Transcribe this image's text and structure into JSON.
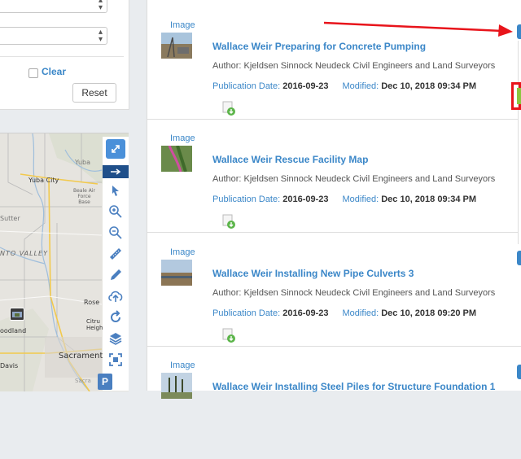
{
  "filters": {
    "clear_label": "Clear",
    "reset_label": "Reset"
  },
  "map": {
    "labels": {
      "yuba_city": "Yuba City",
      "beale": "Beale Air\nForce\nBase",
      "yuba": "Yuba",
      "sutter": "Sutter",
      "valley": "NTO VALLEY",
      "rose": "Rose",
      "citrus": "Citru\nHeigh",
      "woodland": "oodland",
      "sacramento": "Sacramento",
      "davis": "Davis",
      "sacra": "Sacra"
    },
    "tools": [
      {
        "name": "expand-icon"
      },
      {
        "name": "arrow-right-icon"
      },
      {
        "name": "pointer-icon"
      },
      {
        "name": "zoom-in-icon"
      },
      {
        "name": "zoom-out-icon"
      },
      {
        "name": "ruler-icon"
      },
      {
        "name": "pencil-icon"
      },
      {
        "name": "cloud-upload-icon"
      },
      {
        "name": "refresh-icon"
      },
      {
        "name": "layers-icon"
      },
      {
        "name": "fullscreen-icon"
      },
      {
        "name": "parking-icon",
        "label": "P"
      }
    ]
  },
  "results": [
    {
      "type": "Image",
      "title": "Wallace Weir Preparing for Concrete Pumping",
      "author": "Author: Kjeldsen Sinnock Neudeck Civil Engineers and Land Surveyors",
      "pub_label": "Publication Date:",
      "pub_value": "2016-09-23",
      "mod_label": "Modified:",
      "mod_value": "Dec 10, 2018 09:34 PM"
    },
    {
      "type": "Image",
      "title": "Wallace Weir Rescue Facility Map",
      "author": "Author: Kjeldsen Sinnock Neudeck Civil Engineers and Land Surveyors",
      "pub_label": "Publication Date:",
      "pub_value": "2016-09-23",
      "mod_label": "Modified:",
      "mod_value": "Dec 10, 2018 09:34 PM"
    },
    {
      "type": "Image",
      "title": "Wallace Weir Installing New Pipe Culverts 3",
      "author": "Author: Kjeldsen Sinnock Neudeck Civil Engineers and Land Surveyors",
      "pub_label": "Publication Date:",
      "pub_value": "2016-09-23",
      "mod_label": "Modified:",
      "mod_value": "Dec 10, 2018 09:20 PM"
    },
    {
      "type": "Image",
      "title": "Wallace Weir Installing Steel Piles for Structure Foundation 1"
    }
  ],
  "colors": {
    "link": "#3b87c8",
    "annotation_red": "#e8141b",
    "highlight_green": "#8cc63f",
    "tool_blue": "#4a90d9"
  }
}
